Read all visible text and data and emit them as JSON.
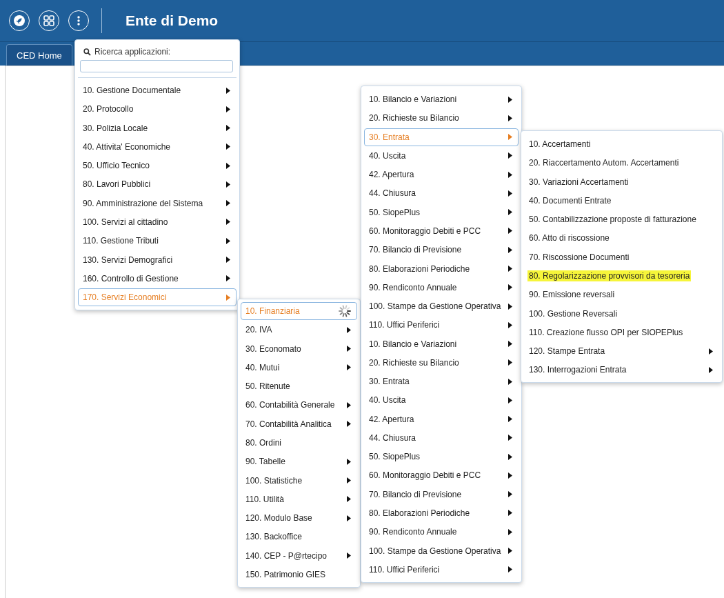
{
  "header": {
    "title": "Ente di Demo"
  },
  "tabs": [
    {
      "label": "CED Home",
      "selected": true
    }
  ],
  "search": {
    "label": "Ricerca applicazioni:"
  },
  "menus": [
    {
      "items": [
        {
          "label": "10. Gestione Documentale",
          "submenu": true,
          "selected": false
        },
        {
          "label": "20. Protocollo",
          "submenu": true,
          "selected": false
        },
        {
          "label": "30. Polizia Locale",
          "submenu": true,
          "selected": false
        },
        {
          "label": "40. Attivita' Economiche",
          "submenu": true,
          "selected": false
        },
        {
          "label": "50. Ufficio Tecnico",
          "submenu": true,
          "selected": false
        },
        {
          "label": "80. Lavori Pubblici",
          "submenu": true,
          "selected": false
        },
        {
          "label": "90. Amministrazione del Sistema",
          "submenu": true,
          "selected": false
        },
        {
          "label": "100. Servizi al cittadino",
          "submenu": true,
          "selected": false
        },
        {
          "label": "110. Gestione Tributi",
          "submenu": true,
          "selected": false
        },
        {
          "label": "130. Servizi Demografici",
          "submenu": true,
          "selected": false
        },
        {
          "label": "160. Controllo di Gestione",
          "submenu": true,
          "selected": false
        },
        {
          "label": "170. Servizi Economici",
          "submenu": true,
          "selected": true
        }
      ]
    },
    {
      "items": [
        {
          "label": "10. Finanziaria",
          "submenu": false,
          "selected": true,
          "loading": true
        },
        {
          "label": "20. IVA",
          "submenu": true,
          "selected": false,
          "loading": false
        },
        {
          "label": "30. Economato",
          "submenu": true,
          "selected": false,
          "loading": false
        },
        {
          "label": "40. Mutui",
          "submenu": true,
          "selected": false,
          "loading": false
        },
        {
          "label": "50. Ritenute",
          "submenu": false,
          "selected": false,
          "loading": false
        },
        {
          "label": "60. Contabilità Generale",
          "submenu": true,
          "selected": false,
          "loading": false
        },
        {
          "label": "70. Contabilità Analitica",
          "submenu": true,
          "selected": false,
          "loading": false
        },
        {
          "label": "80. Ordini",
          "submenu": false,
          "selected": false,
          "loading": false
        },
        {
          "label": "90. Tabelle",
          "submenu": true,
          "selected": false,
          "loading": false
        },
        {
          "label": "100. Statistiche",
          "submenu": true,
          "selected": false,
          "loading": false
        },
        {
          "label": "110. Utilità",
          "submenu": true,
          "selected": false,
          "loading": false
        },
        {
          "label": "120. Modulo Base",
          "submenu": true,
          "selected": false,
          "loading": false
        },
        {
          "label": "130. Backoffice",
          "submenu": false,
          "selected": false,
          "loading": false
        },
        {
          "label": "140. CEP - P@rtecipo",
          "submenu": true,
          "selected": false,
          "loading": false
        },
        {
          "label": "150. Patrimonio GIES",
          "submenu": false,
          "selected": false,
          "loading": false
        }
      ]
    },
    {
      "items": [
        {
          "label": "10. Bilancio e Variazioni",
          "submenu": true,
          "selected": false
        },
        {
          "label": "20. Richieste su Bilancio",
          "submenu": true,
          "selected": false
        },
        {
          "label": "30. Entrata",
          "submenu": true,
          "selected": true
        },
        {
          "label": "40. Uscita",
          "submenu": true,
          "selected": false
        },
        {
          "label": "42. Apertura",
          "submenu": true,
          "selected": false
        },
        {
          "label": "44. Chiusura",
          "submenu": true,
          "selected": false
        },
        {
          "label": "50. SiopePlus",
          "submenu": true,
          "selected": false
        },
        {
          "label": "60. Monitoraggio Debiti e PCC",
          "submenu": true,
          "selected": false
        },
        {
          "label": "70. Bilancio di Previsione",
          "submenu": true,
          "selected": false
        },
        {
          "label": "80. Elaborazioni Periodiche",
          "submenu": true,
          "selected": false
        },
        {
          "label": "90. Rendiconto Annuale",
          "submenu": true,
          "selected": false
        },
        {
          "label": "100. Stampe da Gestione Operativa",
          "submenu": true,
          "selected": false
        },
        {
          "label": "110. Uffici Periferici",
          "submenu": true,
          "selected": false
        },
        {
          "label": "10. Bilancio e Variazioni",
          "submenu": true,
          "selected": false
        },
        {
          "label": "20. Richieste su Bilancio",
          "submenu": true,
          "selected": false
        },
        {
          "label": "30. Entrata",
          "submenu": true,
          "selected": false
        },
        {
          "label": "40. Uscita",
          "submenu": true,
          "selected": false
        },
        {
          "label": "42. Apertura",
          "submenu": true,
          "selected": false
        },
        {
          "label": "44. Chiusura",
          "submenu": true,
          "selected": false
        },
        {
          "label": "50. SiopePlus",
          "submenu": true,
          "selected": false
        },
        {
          "label": "60. Monitoraggio Debiti e PCC",
          "submenu": true,
          "selected": false
        },
        {
          "label": "70. Bilancio di Previsione",
          "submenu": true,
          "selected": false
        },
        {
          "label": "80. Elaborazioni Periodiche",
          "submenu": true,
          "selected": false
        },
        {
          "label": "90. Rendiconto Annuale",
          "submenu": true,
          "selected": false
        },
        {
          "label": "100. Stampe da Gestione Operativa",
          "submenu": true,
          "selected": false
        },
        {
          "label": "110. Uffici Periferici",
          "submenu": true,
          "selected": false
        }
      ]
    },
    {
      "items": [
        {
          "label": "10. Accertamenti",
          "submenu": false,
          "selected": false,
          "highlighted": false
        },
        {
          "label": "20. Riaccertamento Autom. Accertamenti",
          "submenu": false,
          "selected": false,
          "highlighted": false
        },
        {
          "label": "30. Variazioni Accertamenti",
          "submenu": false,
          "selected": false,
          "highlighted": false
        },
        {
          "label": "40. Documenti Entrate",
          "submenu": false,
          "selected": false,
          "highlighted": false
        },
        {
          "label": "50. Contabilizzazione proposte di fatturazione",
          "submenu": false,
          "selected": false,
          "highlighted": false
        },
        {
          "label": "60. Atto di riscossione",
          "submenu": false,
          "selected": false,
          "highlighted": false
        },
        {
          "label": "70. Riscossione Documenti",
          "submenu": false,
          "selected": false,
          "highlighted": false
        },
        {
          "label": "80. Regolarizzazione provvisori da tesoreria",
          "submenu": false,
          "selected": false,
          "highlighted": true
        },
        {
          "label": "90. Emissione reversali",
          "submenu": false,
          "selected": false,
          "highlighted": false
        },
        {
          "label": "100. Gestione Reversali",
          "submenu": false,
          "selected": false,
          "highlighted": false
        },
        {
          "label": "110. Creazione flusso OPI per SIOPEPlus",
          "submenu": false,
          "selected": false,
          "highlighted": false
        },
        {
          "label": "120. Stampe Entrata",
          "submenu": true,
          "selected": false,
          "highlighted": false
        },
        {
          "label": "130. Interrogazioni Entrata",
          "submenu": true,
          "selected": false,
          "highlighted": false
        }
      ]
    }
  ]
}
